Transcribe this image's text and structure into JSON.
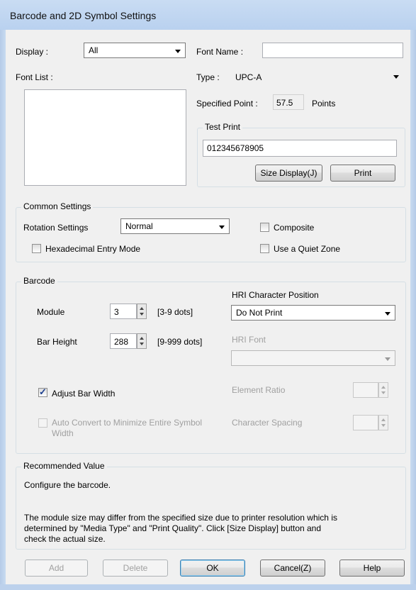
{
  "window": {
    "title": "Barcode and 2D Symbol Settings"
  },
  "display": {
    "label": "Display :",
    "value": "All"
  },
  "font_name": {
    "label": "Font Name :",
    "value": ""
  },
  "font_list": {
    "label": "Font List :"
  },
  "type": {
    "label": "Type :",
    "value": "UPC-A"
  },
  "specified_point": {
    "label": "Specified Point :",
    "value": "57.5",
    "unit": "Points"
  },
  "test_print": {
    "title": "Test Print",
    "value": "012345678905",
    "size_display_label": "Size Display(J)",
    "print_label": "Print"
  },
  "common_settings": {
    "title": "Common Settings",
    "rotation_label": "Rotation Settings",
    "rotation_value": "Normal",
    "composite_label": "Composite",
    "composite_checked": false,
    "hex_label": "Hexadecimal Entry Mode",
    "hex_checked": false,
    "quiet_zone_label": "Use a Quiet Zone",
    "quiet_zone_checked": false
  },
  "barcode": {
    "title": "Barcode",
    "module_label": "Module",
    "module_value": "3",
    "module_range": "[3-9 dots]",
    "bar_height_label": "Bar Height",
    "bar_height_value": "288",
    "bar_height_range": "[9-999 dots]",
    "hri_position_label": "HRI Character Position",
    "hri_position_value": "Do Not Print",
    "hri_font_label": "HRI Font",
    "hri_font_value": "",
    "adjust_bar_width_label": "Adjust Bar Width",
    "adjust_bar_width_checked": true,
    "element_ratio_label": "Element Ratio",
    "auto_convert_label_1": "Auto Convert to Minimize Entire Symbol",
    "auto_convert_label_2": "Width",
    "auto_convert_checked": false,
    "char_spacing_label": "Character Spacing"
  },
  "recommended": {
    "title": "Recommended Value",
    "line1": "Configure the barcode.",
    "line2": "The module size may differ from the specified size due to printer resolution which is",
    "line3": "determined by \"Media Type\" and \"Print Quality\". Click [Size Display] button and",
    "line4": "check the actual size."
  },
  "buttons": {
    "add": "Add",
    "delete": "Delete",
    "ok": "OK",
    "cancel": "Cancel(Z)",
    "help": "Help"
  }
}
